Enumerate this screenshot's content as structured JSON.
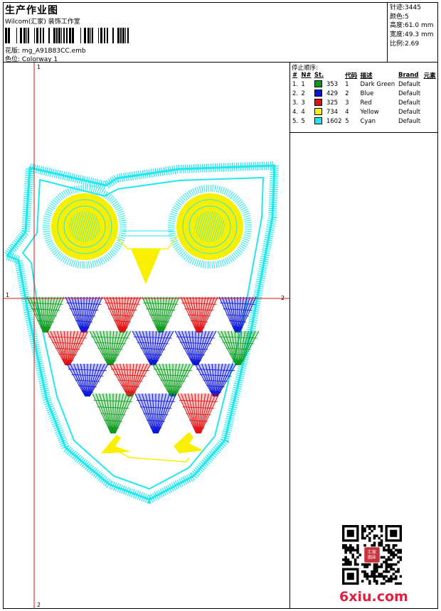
{
  "header": {
    "title": "生产作业图",
    "company": "Wilcom(汇家) 装饰工作室",
    "design_label": "花版:",
    "design_value": "mg_A91B83CC.emb",
    "colorway_label": "色位:",
    "colorway_value": "Colorway 1"
  },
  "stats": [
    {
      "label": "针迹:",
      "value": "3445"
    },
    {
      "label": "颜色:",
      "value": "5"
    },
    {
      "label": "高度:",
      "value": "61.0 mm"
    },
    {
      "label": "宽度:",
      "value": "49.3 mm"
    },
    {
      "label": "比例:",
      "value": "2.69"
    }
  ],
  "stop_sequence": {
    "caption": "停止顺序:",
    "columns": [
      "#",
      "N#",
      "St.",
      "代码",
      "描述",
      "Brand",
      "元素"
    ],
    "rows": [
      {
        "num": "1.",
        "n": "1",
        "color": "#0a9a1a",
        "stitches": "353",
        "code": "1",
        "desc": "Dark Green",
        "brand": "Default"
      },
      {
        "num": "2.",
        "n": "2",
        "color": "#0a14d8",
        "stitches": "429",
        "code": "2",
        "desc": "Blue",
        "brand": "Default"
      },
      {
        "num": "3.",
        "n": "3",
        "color": "#e01010",
        "stitches": "325",
        "code": "3",
        "desc": "Red",
        "brand": "Default"
      },
      {
        "num": "4.",
        "n": "4",
        "color": "#f8f000",
        "stitches": "734",
        "code": "4",
        "desc": "Yellow",
        "brand": "Default"
      },
      {
        "num": "5.",
        "n": "5",
        "color": "#20e8f0",
        "stitches": "1602",
        "code": "5",
        "desc": "Cyan",
        "brand": "Default"
      }
    ]
  },
  "canvas": {
    "markers": {
      "top": "1",
      "bottom": "2",
      "left": "1",
      "right": "2"
    },
    "guide_color": "#e01010"
  },
  "watermark": {
    "text": "6xiu.com",
    "seal_text": "汇家\n图库"
  }
}
